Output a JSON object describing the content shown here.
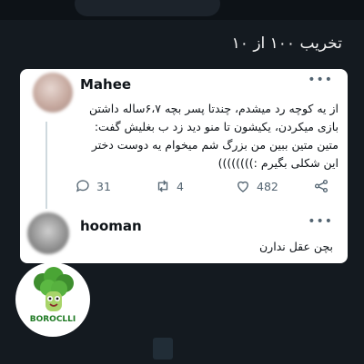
{
  "heading": "تخریب ۱۰۰ از ۱۰",
  "tweet": {
    "author": "Mahee",
    "more": "•••",
    "lines": [
      "از یه کوچه رد میشدم، چندتا پسر بچه ۶،۷ساله داشتن",
      "بازی میکردن، یکیشون تا منو دید زد ب بغلیش گفت:",
      "متین متین ببین من بزرگ شم میخوام یه دوست دختر",
      "این شکلی بگیرم :))))))))"
    ],
    "replies": "31",
    "retweets": "4",
    "likes": "482"
  },
  "reply": {
    "author": "hooman",
    "more": "•••",
    "text": "بچن عقل ندارن"
  },
  "logo": {
    "text": "BOROCLLI",
    "icon": "broccoli-mascot-icon"
  },
  "colors": {
    "background": "#141a20",
    "card": "#ffffff",
    "icon": "#536471"
  }
}
